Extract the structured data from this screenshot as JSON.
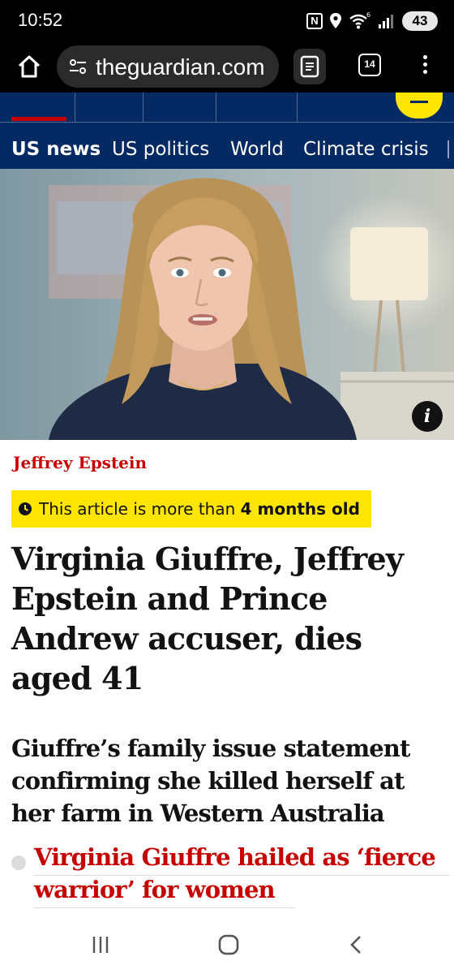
{
  "status_bar": {
    "time": "10:52",
    "battery": "43",
    "icons": [
      "nfc-icon",
      "location-icon",
      "wifi-6-icon",
      "signal-icon",
      "battery-charging-icon"
    ]
  },
  "browser": {
    "url": "theguardian.com",
    "tab_count": "14",
    "icons": [
      "home-icon",
      "site-settings-icon",
      "reader-mode-icon",
      "tab-switcher-icon",
      "more-vert-icon"
    ]
  },
  "nav": {
    "subsections": [
      "US news",
      "US politics",
      "World",
      "Climate crisis"
    ],
    "active_subsection": "US news",
    "brand_colors": {
      "navy": "#052962",
      "red": "#c70000",
      "yellow": "#ffe500"
    }
  },
  "article": {
    "kicker": "Jeffrey Epstein",
    "age_warning_prefix": "This article is more than ",
    "age_warning_strong": "4 months old",
    "headline": "Virginia Giuffre, Jeffrey Epstein and Prince Andrew accuser, dies aged 41",
    "standfirst": "Giuffre’s family issue statement confirming she killed herself at her farm in Western Australia",
    "related_link": "Virginia Giuffre hailed as ‘fierce warrior’ for women",
    "info_icon_label": "i"
  },
  "system_nav": {
    "icons": [
      "recents-icon",
      "home-circle-icon",
      "back-icon"
    ]
  }
}
